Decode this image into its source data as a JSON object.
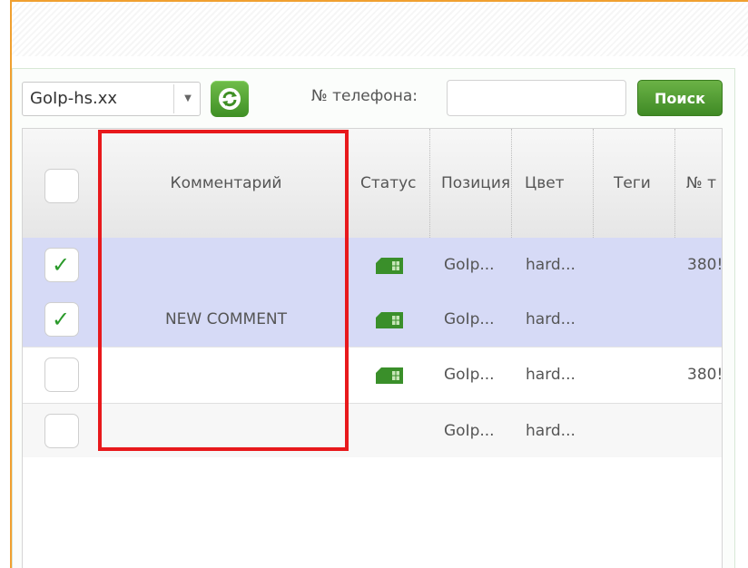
{
  "toolbar": {
    "server_select": "GoIp-hs.xx",
    "phone_label": "№ телефона:",
    "phone_value": "",
    "search_label": "Поиск"
  },
  "grid": {
    "columns": [
      "Комментарий",
      "Статус",
      "Позиция",
      "Цвет",
      "Теги",
      "№ т"
    ],
    "rows": [
      {
        "selected": true,
        "comment": "",
        "status_icon": "sim-card-icon",
        "position": "GoIp...",
        "color": "hard...",
        "phone": "380!"
      },
      {
        "selected": true,
        "comment": "NEW COMMENT",
        "status_icon": "sim-card-icon",
        "position": "GoIp...",
        "color": "hard...",
        "phone": ""
      },
      {
        "selected": false,
        "comment": "",
        "status_icon": "sim-card-icon",
        "position": "GoIp...",
        "color": "hard...",
        "phone": "380!"
      },
      {
        "selected": false,
        "comment": "",
        "status_icon": "",
        "position": "GoIp...",
        "color": "hard...",
        "phone": ""
      }
    ]
  },
  "colors": {
    "accent_green": "#4a9a2e",
    "selected_row": "#d6daf6",
    "highlight_red": "#e8191c",
    "frame_orange": "#f0a030"
  }
}
